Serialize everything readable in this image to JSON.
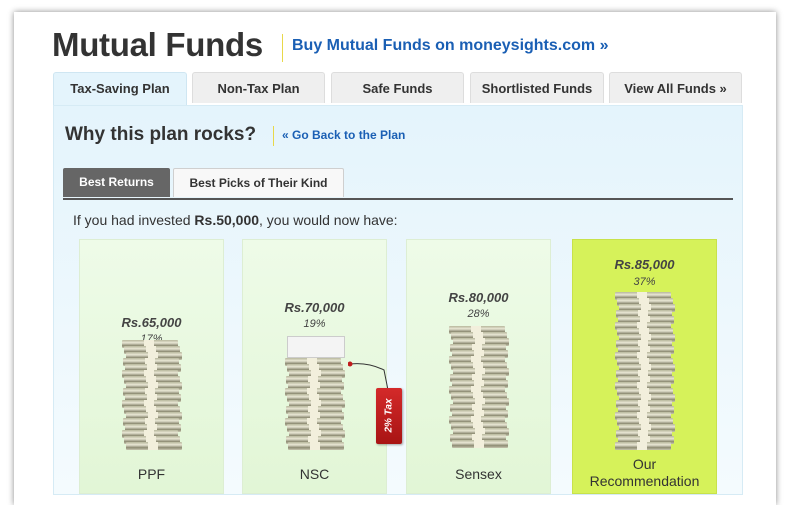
{
  "header": {
    "title": "Mutual Funds",
    "buy_link": "Buy Mutual Funds on moneysights.com »"
  },
  "tabs": [
    {
      "label": "Tax-Saving Plan",
      "active": true
    },
    {
      "label": "Non-Tax Plan",
      "active": false
    },
    {
      "label": "Safe Funds",
      "active": false
    },
    {
      "label": "Shortlisted Funds",
      "active": false
    },
    {
      "label": "View All Funds »",
      "active": false
    }
  ],
  "panel": {
    "heading": "Why this plan rocks?",
    "back_link": "« Go Back to the Plan",
    "subtabs": [
      {
        "label": "Best Returns",
        "active": true
      },
      {
        "label": "Best Picks of Their Kind",
        "active": false
      }
    ],
    "intro_prefix": "If you had invested ",
    "intro_amount": "Rs.50,000",
    "intro_suffix": ", you would now have:"
  },
  "cards": [
    {
      "amount": "Rs.65,000",
      "percent": "17%",
      "label": "PPF",
      "highlight": false
    },
    {
      "amount": "Rs.70,000",
      "percent": "19%",
      "label": "NSC",
      "highlight": false,
      "tag": "2% Tax"
    },
    {
      "amount": "Rs.80,000",
      "percent": "28%",
      "label": "Sensex",
      "highlight": false
    },
    {
      "amount": "Rs.85,000",
      "percent": "37%",
      "label_line1": "Our",
      "label_line2": "Recommendation",
      "highlight": true
    }
  ],
  "colors": {
    "link": "#1a5fb4",
    "panel_bg": "#e4f4fc",
    "card_bg": "#e2f6d6",
    "highlight_bg": "#d6f25a",
    "tag_red": "#c01c1c"
  },
  "icons": {
    "money_stack": "money-stack-icon",
    "tax_tag": "price-tag-icon"
  }
}
